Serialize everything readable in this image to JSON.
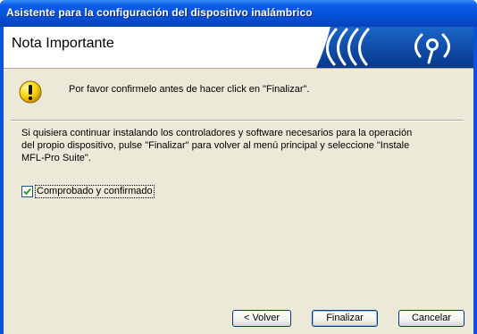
{
  "window": {
    "title": "Asistente para la configuración del dispositivo inalámbrico"
  },
  "header": {
    "title": "Nota Importante",
    "logo_icon": "wireless-signal-logo"
  },
  "note": {
    "icon": "warning-icon",
    "text": "Por favor confirmelo antes de hacer click en \"Finalizar\"."
  },
  "body": {
    "line1": "Si quisiera continuar instalando los controladores y software necesarios para la operación",
    "line2": "del propio dispositivo, pulse \"Finalizar\" para volver al menú principal y seleccione \"Instale",
    "line3": "MFL-Pro Suite\"."
  },
  "checkbox": {
    "label": "Comprobado y confirmado",
    "checked": true
  },
  "buttons": {
    "back": "< Volver",
    "finish": "Finalizar",
    "cancel": "Cancelar"
  },
  "colors": {
    "titlebar": "#0452d8",
    "dialog_bg": "#ece9d8",
    "logo_blue": "#0a3f9c"
  }
}
